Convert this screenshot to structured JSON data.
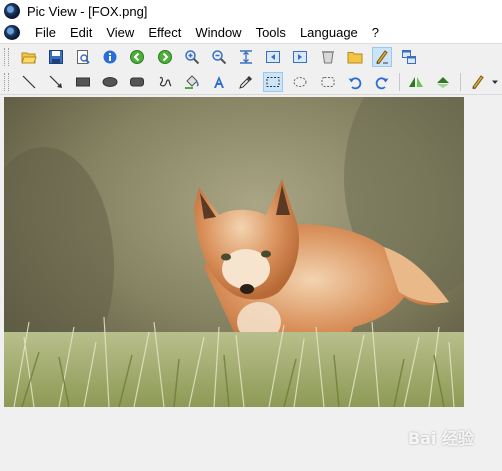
{
  "window": {
    "title": "Pic View - [FOX.png]"
  },
  "menu": [
    "File",
    "Edit",
    "View",
    "Effect",
    "Window",
    "Tools",
    "Language",
    "?"
  ],
  "toolbar1": [
    {
      "name": "open-folder-icon"
    },
    {
      "name": "save-icon"
    },
    {
      "name": "print-preview-icon"
    },
    {
      "name": "info-icon"
    },
    {
      "name": "previous-icon"
    },
    {
      "name": "next-icon"
    },
    {
      "name": "zoom-in-icon"
    },
    {
      "name": "zoom-out-icon"
    },
    {
      "name": "fit-size-icon"
    },
    {
      "name": "first-image-icon"
    },
    {
      "name": "last-image-icon"
    },
    {
      "name": "delete-icon"
    },
    {
      "name": "folder-icon"
    },
    {
      "name": "draw-mode-icon",
      "active": true
    },
    {
      "name": "windows-icon"
    }
  ],
  "toolbar2": [
    {
      "name": "line-icon"
    },
    {
      "name": "arrow-icon"
    },
    {
      "name": "rectangle-icon"
    },
    {
      "name": "ellipse-icon"
    },
    {
      "name": "rounded-rectangle-icon"
    },
    {
      "name": "freehand-icon"
    },
    {
      "name": "fill-icon"
    },
    {
      "name": "text-icon"
    },
    {
      "name": "eyedropper-icon"
    },
    {
      "name": "rect-select-icon",
      "active": true
    },
    {
      "name": "ellipse-select-icon"
    },
    {
      "name": "rounded-select-icon"
    },
    {
      "name": "undo-icon"
    },
    {
      "name": "redo-icon"
    },
    {
      "name": "flip-horizontal-icon"
    },
    {
      "name": "flip-vertical-icon"
    },
    {
      "name": "pen-color-icon"
    }
  ],
  "image": {
    "file": "FOX.png",
    "subject": "fox-photo"
  },
  "watermark": {
    "text": "Bai 经验"
  }
}
